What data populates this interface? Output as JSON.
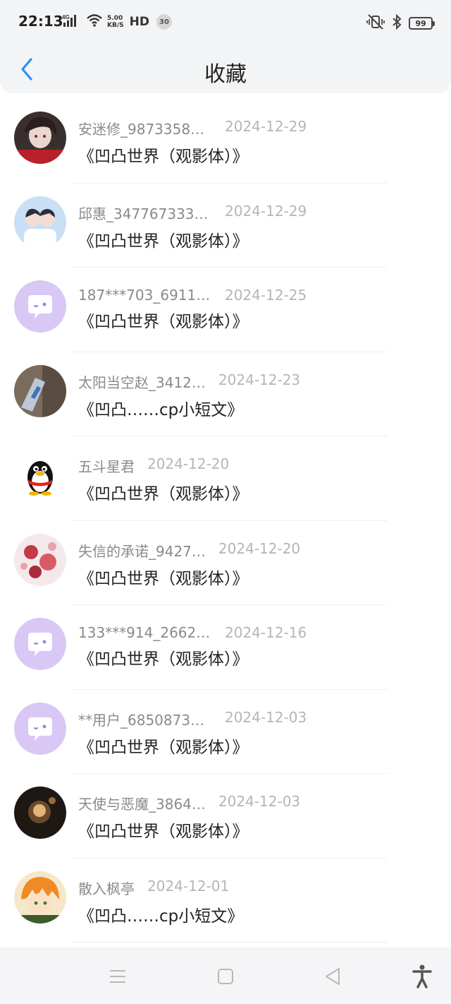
{
  "status_bar": {
    "time": "22:13",
    "network": "4G",
    "speed_value": "5.00",
    "speed_unit": "KB/S",
    "hd": "HD",
    "notification_count": "30",
    "battery": "99"
  },
  "header": {
    "title": "收藏"
  },
  "favorites": [
    {
      "user": "安迷修_98733583…",
      "date": "2024-12-29",
      "title": "《凹凸世界（观影体）》",
      "avatar": "avatar-dark-hair"
    },
    {
      "user": "邱惠_3477673331…",
      "date": "2024-12-29",
      "title": "《凹凸世界（观影体）》",
      "avatar": "avatar-two-people"
    },
    {
      "user": "187***703_69116…",
      "date": "2024-12-25",
      "title": "《凹凸世界（观影体）》",
      "avatar": "default-chat-avatar"
    },
    {
      "user": "太阳当空赵_3412…",
      "date": "2024-12-23",
      "title": "《凹凸……cp小短文》",
      "avatar": "avatar-photo"
    },
    {
      "user": "五斗星君",
      "date": "2024-12-20",
      "title": "《凹凸世界（观影体）》",
      "avatar": "qq-penguin-avatar"
    },
    {
      "user": "失信的承诺_9427…",
      "date": "2024-12-20",
      "title": "《凹凸世界（观影体）》",
      "avatar": "avatar-red-floral"
    },
    {
      "user": "133***914_26623…",
      "date": "2024-12-16",
      "title": "《凹凸世界（观影体）》",
      "avatar": "default-chat-avatar"
    },
    {
      "user": "**用户_68508731…",
      "date": "2024-12-03",
      "title": "《凹凸世界（观影体）》",
      "avatar": "default-chat-avatar"
    },
    {
      "user": "天使与恶魔_3864…",
      "date": "2024-12-03",
      "title": "《凹凸世界（观影体）》",
      "avatar": "avatar-dark-fire"
    },
    {
      "user": "散入枫亭",
      "date": "2024-12-01",
      "title": "《凹凸……cp小短文》",
      "avatar": "avatar-orange-anime"
    }
  ],
  "colors": {
    "accent": "#2f8ef5",
    "default_avatar_bg": "#d9c8f6",
    "muted_text": "#8a8a8a",
    "date_text": "#b5b5b5"
  }
}
